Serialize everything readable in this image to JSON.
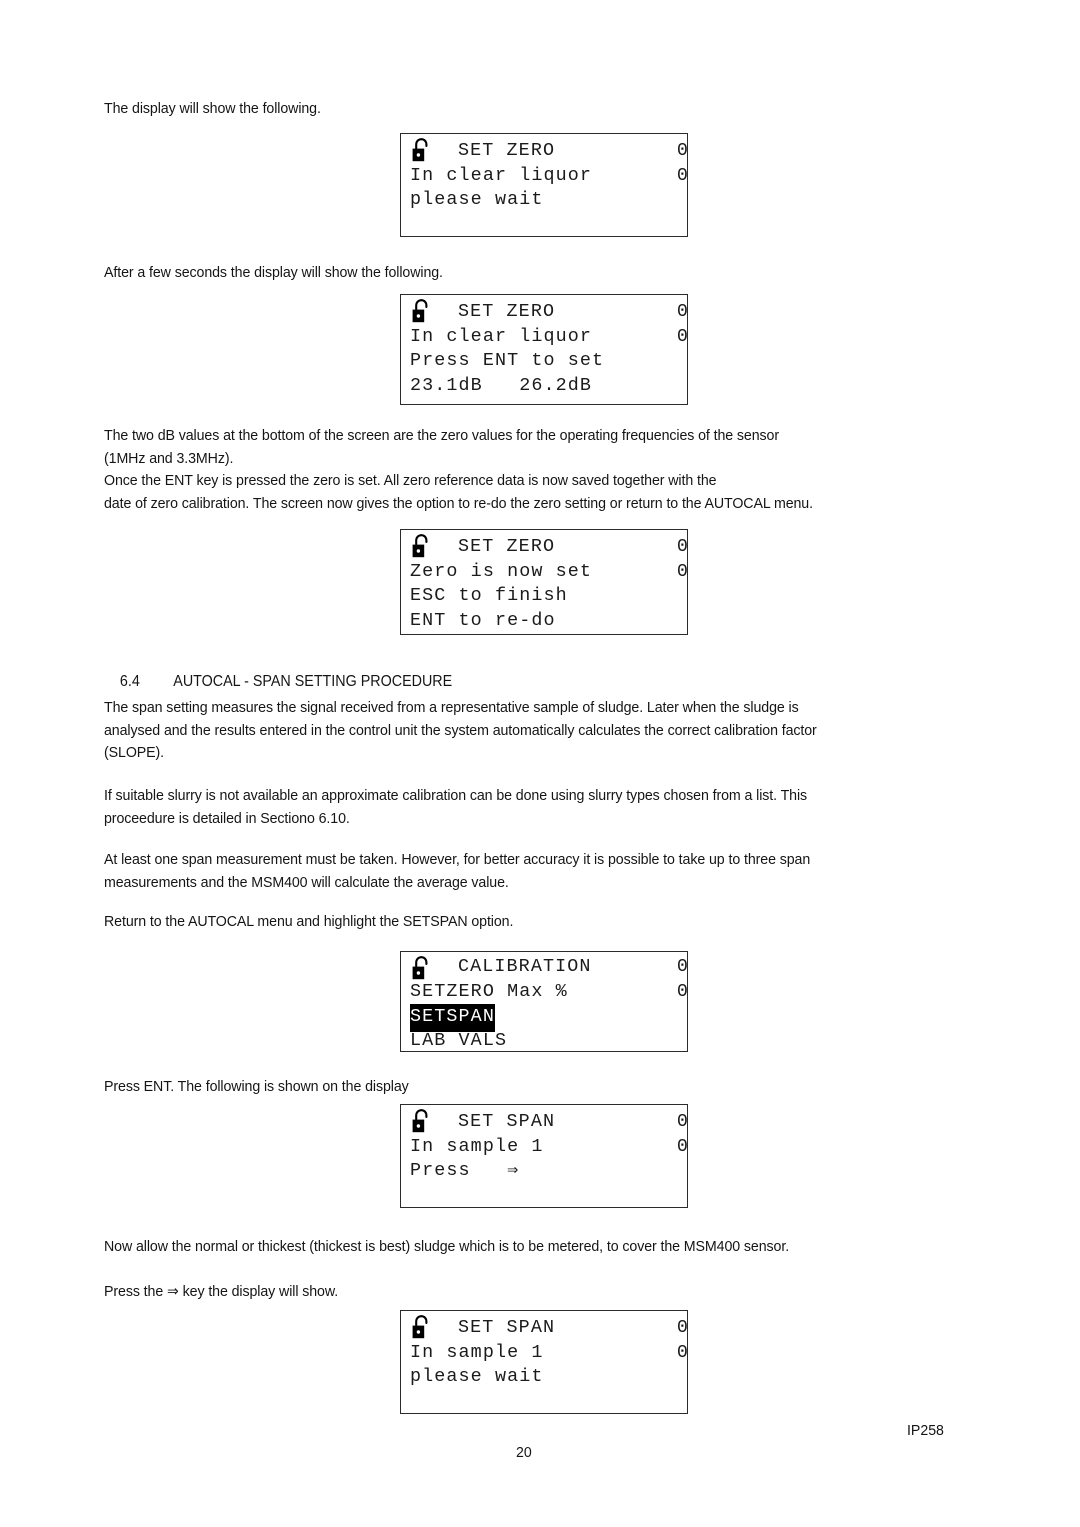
{
  "page": {
    "number": "20",
    "doc_code": "IP258"
  },
  "intro": {
    "line1": "The display will show the following."
  },
  "after_seconds": {
    "line1": "After a few seconds the display will show the following."
  },
  "db_note": {
    "line1": "The two dB values at the bottom of the screen are the zero values for the operating frequencies of the sensor",
    "line2": "(1MHz and 3.3MHz).",
    "line3": "Once the ENT key is pressed the zero is set. All zero reference data is now saved together with the",
    "line4": "date of zero calibration. The screen now gives the option to re-do the zero setting or return to the AUTOCAL menu."
  },
  "section": {
    "number": "6.4",
    "title": "AUTOCAL - SPAN SETTING PROCEDURE"
  },
  "span_intro": {
    "line1": "The span setting measures the signal received from a representative sample of sludge. Later when the sludge is",
    "line2": "analysed and the results entered in the control unit the system automatically calculates the correct calibration factor",
    "line3": "(SLOPE)."
  },
  "slurry_note": {
    "line1": "If suitable slurry is not available an approximate calibration can be done using slurry types chosen from a list.  This",
    "line2": "proceedure is detailed in Sectiono 6.10."
  },
  "span_count_note": {
    "line1": "At least one span measurement must be taken. However, for better accuracy it is possible to take up to three span",
    "line2": "measurements and the MSM400 will calculate the average value."
  },
  "return_note": {
    "line1": "Return to the AUTOCAL menu and highlight the SETSPAN option."
  },
  "press_ent_note": {
    "line1": "Press ENT. The following is shown on the display"
  },
  "sludge_note": {
    "line1": "Now allow the normal or thickest (thickest is best) sludge which is to be metered, to cover the MSM400 sensor."
  },
  "press_key_note": {
    "line1": "Press the ⇒ key the display will show."
  },
  "displays": [
    {
      "id": "set-zero-wait",
      "icon": "open-padlock-icon",
      "title": "SET ZERO",
      "rows": [
        {
          "text": "In clear liquor",
          "right": "0"
        },
        {
          "text": "please wait",
          "right": ""
        },
        {
          "text": "",
          "right": ""
        }
      ],
      "title_right": "0"
    },
    {
      "id": "set-zero-press-ent",
      "icon": "open-padlock-icon",
      "title": "SET ZERO",
      "rows": [
        {
          "text": "In clear liquor",
          "right": "0"
        },
        {
          "text": "Press ENT to set",
          "right": ""
        },
        {
          "text": "23.1dB   26.2dB",
          "right": ""
        }
      ],
      "title_right": "0"
    },
    {
      "id": "set-zero-done",
      "icon": "open-padlock-icon",
      "title": "SET ZERO",
      "rows": [
        {
          "text": "Zero is now set",
          "right": "0"
        },
        {
          "text": "ESC to finish",
          "right": ""
        },
        {
          "text": "ENT to re-do",
          "right": ""
        }
      ],
      "title_right": "0"
    },
    {
      "id": "calibration-menu",
      "icon": "open-padlock-icon",
      "title": "CALIBRATION",
      "rows": [
        {
          "text": "SETZERO Max %",
          "right": "0"
        },
        {
          "text": "SETSPAN",
          "right": "",
          "highlight": true
        },
        {
          "text": "LAB VALS",
          "right": ""
        }
      ],
      "title_right": "0"
    },
    {
      "id": "set-span-press",
      "icon": "open-padlock-icon",
      "title": "SET SPAN",
      "rows": [
        {
          "text": "In sample 1",
          "right": "0"
        },
        {
          "text": "Press   ⇒",
          "right": ""
        },
        {
          "text": "",
          "right": ""
        }
      ],
      "title_right": "0"
    },
    {
      "id": "set-span-wait",
      "icon": "open-padlock-icon",
      "title": "SET SPAN",
      "rows": [
        {
          "text": "In sample 1",
          "right": "0"
        },
        {
          "text": "please wait",
          "right": ""
        },
        {
          "text": "",
          "right": ""
        }
      ],
      "title_right": "0"
    }
  ],
  "colors": {
    "text": "#151515",
    "border": "#2b2b2b",
    "highlight_bg": "#000000",
    "highlight_fg": "#ffffff",
    "page_bg": "#ffffff"
  }
}
